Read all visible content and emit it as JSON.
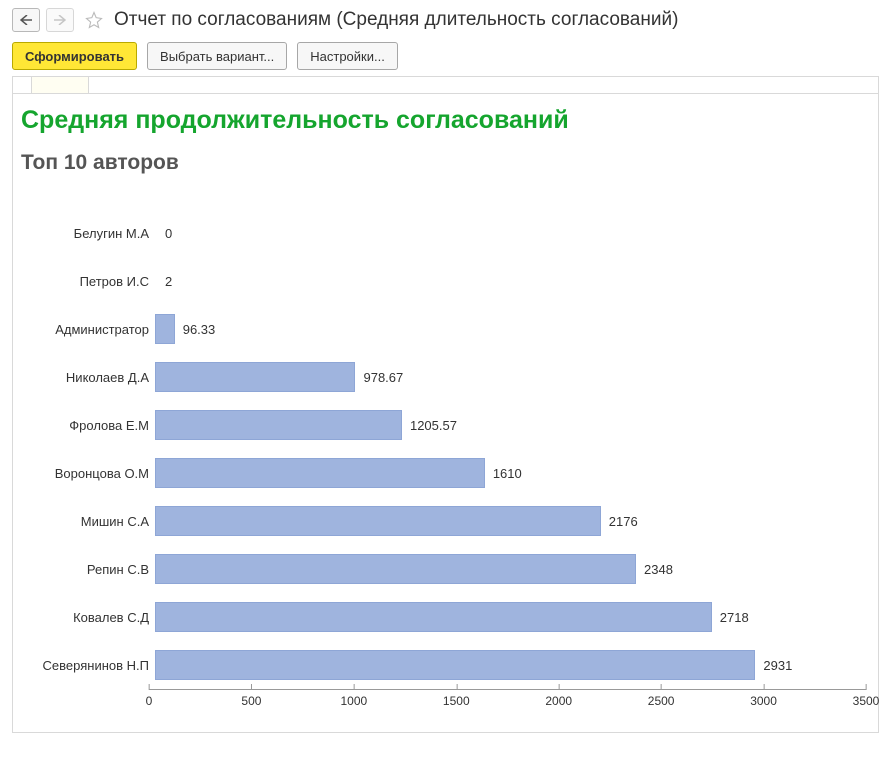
{
  "header": {
    "title": "Отчет по согласованиям (Средняя длительность согласований)"
  },
  "toolbar": {
    "generate": "Сформировать",
    "select_variant": "Выбрать вариант...",
    "settings": "Настройки..."
  },
  "report": {
    "title": "Средняя продолжительность согласований",
    "subtitle": "Топ 10 авторов"
  },
  "chart_data": {
    "type": "bar",
    "orientation": "horizontal",
    "categories": [
      "Белугин М.А",
      "Петров И.С",
      "Администратор",
      "Николаев Д.А",
      "Фролова Е.М",
      "Воронцова О.М",
      "Мишин С.А",
      "Репин С.В",
      "Ковалев С.Д",
      "Северянинов Н.П"
    ],
    "values": [
      0,
      2,
      96.33,
      978.67,
      1205.57,
      1610,
      2176,
      2348,
      2718,
      2931
    ],
    "xlabel": "",
    "ylabel": "",
    "xlim": [
      0,
      3500
    ],
    "x_ticks": [
      0,
      500,
      1000,
      1500,
      2000,
      2500,
      3000,
      3500
    ],
    "bar_color": "#9fb4de"
  }
}
